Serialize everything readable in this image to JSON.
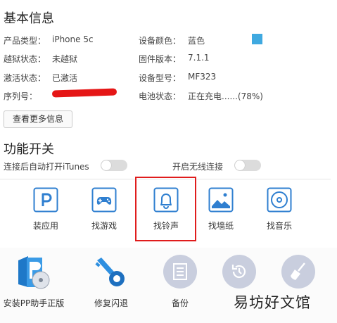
{
  "basic_info": {
    "title": "基本信息",
    "rows": [
      {
        "label": "产品类型：",
        "value": "iPhone 5c",
        "label2": "设备颜色：",
        "value2": "蓝色"
      },
      {
        "label": "越狱状态：",
        "value": "未越狱",
        "label2": "固件版本：",
        "value2": "7.1.1"
      },
      {
        "label": "激活状态：",
        "value": "已激活",
        "label2": "设备型号：",
        "value2": "MF323"
      },
      {
        "label": "序列号：",
        "value": "",
        "label2": "电池状态：",
        "value2": "正在充电......(78%)"
      }
    ],
    "more_button": "查看更多信息",
    "device_color_hex": "#3fa9e0"
  },
  "switches": {
    "title": "功能开关",
    "items": [
      {
        "label": "连接后自动打开iTunes",
        "on": false
      },
      {
        "label": "开启无线连接",
        "on": false
      }
    ]
  },
  "functions": [
    {
      "label": "装应用",
      "icon": "app-store-icon"
    },
    {
      "label": "找游戏",
      "icon": "gamepad-icon"
    },
    {
      "label": "找铃声",
      "icon": "bell-icon"
    },
    {
      "label": "找墙纸",
      "icon": "wallpaper-icon"
    },
    {
      "label": "找音乐",
      "icon": "music-disc-icon"
    }
  ],
  "tools": [
    {
      "label": "安装PP助手正版",
      "icon": "pp-install-icon"
    },
    {
      "label": "修复闪退",
      "icon": "repair-key-icon"
    },
    {
      "label": "备份",
      "icon": "backup-icon"
    },
    {
      "label": "",
      "icon": "restore-icon"
    },
    {
      "label": "",
      "icon": "clean-broom-icon"
    }
  ],
  "watermark": "易坊好文馆",
  "colors": {
    "accent_blue": "#2f7fd0",
    "highlight_red": "#e01c1c",
    "tool_circle": "#c9cede"
  }
}
